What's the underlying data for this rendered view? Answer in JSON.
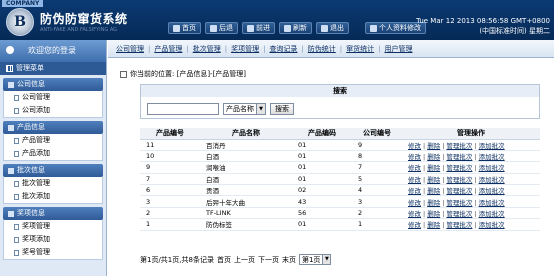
{
  "header": {
    "company_tab": "COMPANY",
    "title": "防伪防窜货系统",
    "subtitle": "ANTI-FAKE AND FALSIFYING AG",
    "logo_letter": "B",
    "buttons": [
      {
        "label": "首页",
        "icon": "home-icon"
      },
      {
        "label": "后退",
        "icon": "back-icon"
      },
      {
        "label": "前进",
        "icon": "forward-icon"
      },
      {
        "label": "刷新",
        "icon": "refresh-icon"
      },
      {
        "label": "退出",
        "icon": "exit-icon"
      }
    ],
    "profile_button": "个人资料修改",
    "clock_line1": "Tue Mar 12 2013 08:56:58 GMT+0800",
    "clock_line2": "(中国标准时间) 星期二"
  },
  "sidebar": {
    "welcome": "欢迎您的登录",
    "menu_head": "管理菜单",
    "groups": [
      {
        "title": "公司信息",
        "items": [
          "公司管理",
          "公司添加"
        ]
      },
      {
        "title": "产品信息",
        "items": [
          "产品管理",
          "产品添加"
        ]
      },
      {
        "title": "批次信息",
        "items": [
          "批次管理",
          "批次添加"
        ]
      },
      {
        "title": "奖项信息",
        "items": [
          "奖项管理",
          "奖项添加",
          "奖号管理"
        ]
      }
    ]
  },
  "tabs": [
    "公司管理",
    "产品管理",
    "批次管理",
    "奖项管理",
    "查询记录",
    "防伪统计",
    "窜货统计",
    "用户管理"
  ],
  "breadcrumb": "你当前的位置: [产品信息]-[产品管理]",
  "search": {
    "title": "搜索",
    "input_value": "",
    "select_value": "产品名称",
    "button": "搜索"
  },
  "table": {
    "headers": [
      "产品编号",
      "产品名称",
      "产品编码",
      "公司编号",
      "管理操作"
    ],
    "rows": [
      [
        "11",
        "百消丹",
        "01",
        "9"
      ],
      [
        "10",
        "白酒",
        "01",
        "8"
      ],
      [
        "9",
        "润喉油",
        "01",
        "7"
      ],
      [
        "7",
        "白酒",
        "01",
        "5"
      ],
      [
        "6",
        "贡酒",
        "02",
        "4"
      ],
      [
        "3",
        "后羿十年大曲",
        "43",
        "3"
      ],
      [
        "2",
        "TF-LINK",
        "56",
        "2"
      ],
      [
        "1",
        "防伪标签",
        "01",
        "1"
      ]
    ],
    "ops": [
      "修改",
      "删除",
      "管理批次",
      "添加批次"
    ]
  },
  "pager": {
    "info": "第1页/共1页,共8条记录",
    "links": [
      "首页",
      "上一页",
      "下一页",
      "末页"
    ],
    "select_value": "第1页"
  }
}
